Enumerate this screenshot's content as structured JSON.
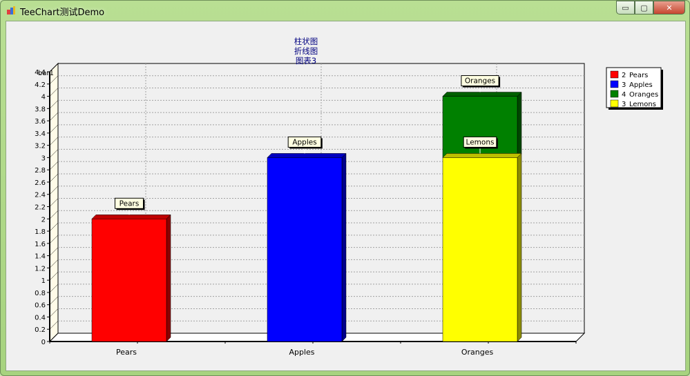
{
  "window": {
    "title": "TeeChart测试Demo",
    "controls": {
      "minimize": "▭",
      "maximize": "▢",
      "close": "✕"
    }
  },
  "chart_data": {
    "type": "bar",
    "title_lines": [
      "柱状图",
      "折线图",
      "图表3"
    ],
    "axis_title": "bar1",
    "categories": [
      "Pears",
      "Apples",
      "Oranges"
    ],
    "ylim": [
      0,
      4.4
    ],
    "y_ticks": [
      "0",
      "0.2",
      "0.4",
      "0.6",
      "0.8",
      "1",
      "1.2",
      "1.4",
      "1.6",
      "1.8",
      "2",
      "2.2",
      "2.4",
      "2.6",
      "2.8",
      "3",
      "3.2",
      "3.4",
      "3.6",
      "3.8",
      "4",
      "4.2",
      "4.4"
    ],
    "grid": true,
    "stacked": true,
    "legend_position": "top-right",
    "bars": [
      {
        "category": "Pears",
        "base": 0,
        "value": 2,
        "label": "Pears",
        "color": "#ff0000"
      },
      {
        "category": "Apples",
        "base": 0,
        "value": 3,
        "label": "Apples",
        "color": "#0000ff"
      },
      {
        "category": "Oranges",
        "base": 3,
        "value": 1,
        "label": "Oranges",
        "color": "#008000"
      },
      {
        "category": "Oranges",
        "base": 0,
        "value": 3,
        "label": "Lemons",
        "color": "#ffff00"
      }
    ],
    "legend": [
      {
        "value": "2",
        "name": "Pears",
        "color": "#ff0000"
      },
      {
        "value": "3",
        "name": "Apples",
        "color": "#0000ff"
      },
      {
        "value": "4",
        "name": "Oranges",
        "color": "#008000"
      },
      {
        "value": "3",
        "name": "Lemons",
        "color": "#ffff00"
      }
    ]
  }
}
